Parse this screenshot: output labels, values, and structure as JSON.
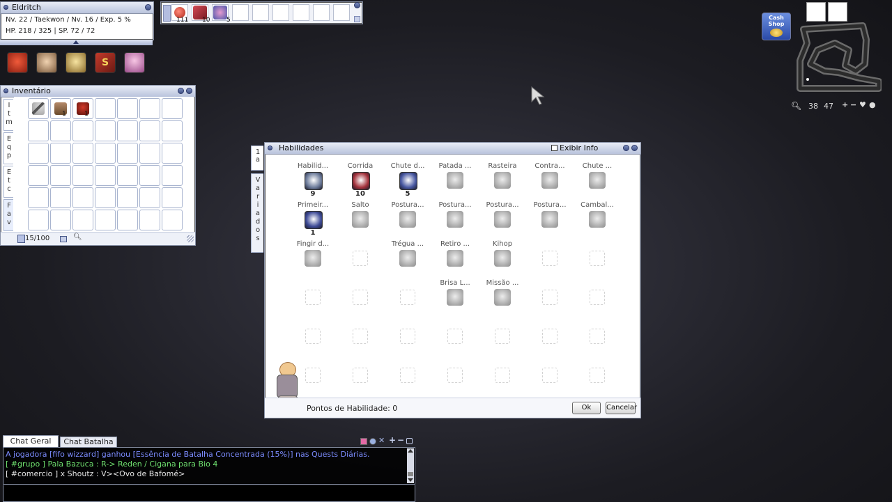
{
  "character": {
    "name": "Eldritch",
    "level_line": "Nv. 22 / Taekwon / Nv. 16 / Exp. 5 %",
    "hp_sp_line": "HP. 218 / 325 | SP. 72 / 72"
  },
  "hotbar": {
    "counts": [
      "111",
      "10",
      "5"
    ]
  },
  "minimap": {
    "cash_shop_label": "Cash Shop",
    "coord_x": "38",
    "coord_y": "47"
  },
  "inventory": {
    "title": "Inventário",
    "tabs": [
      "Itm",
      "Eqp",
      "Etc",
      "Fav"
    ],
    "capacity": "15/100",
    "items": [
      {
        "icon": "staff-icon",
        "count": ""
      },
      {
        "icon": "shirt-icon",
        "count": "1"
      },
      {
        "icon": "hood-icon",
        "count": "1"
      }
    ]
  },
  "skills": {
    "title": "Habilidades",
    "exibir_info": "Exibir Info",
    "tabs": [
      "1a",
      "Variados"
    ],
    "rows": [
      [
        {
          "name": "Habilid...",
          "level": "9",
          "learned": true,
          "color": "#6c7b9a"
        },
        {
          "name": "Corrida",
          "level": "10",
          "learned": true,
          "color": "#a2303a"
        },
        {
          "name": "Chute d...",
          "level": "5",
          "learned": true,
          "color": "#4656a0"
        },
        {
          "name": "Patada ...",
          "level": "",
          "learned": false,
          "color": "#8a8a8a"
        },
        {
          "name": "Rasteira",
          "level": "",
          "learned": false,
          "color": "#8a8a8a"
        },
        {
          "name": "Contra...",
          "level": "",
          "learned": false,
          "color": "#8a8a8a"
        },
        {
          "name": "Chute ...",
          "level": "",
          "learned": false,
          "color": "#8a8a8a"
        }
      ],
      [
        {
          "name": "Primeir...",
          "level": "1",
          "learned": true,
          "color": "#3d4a96"
        },
        {
          "name": "Salto",
          "level": "",
          "learned": false,
          "color": "#8a8a8a"
        },
        {
          "name": "Postura...",
          "level": "",
          "learned": false,
          "color": "#8a8a8a"
        },
        {
          "name": "Postura...",
          "level": "",
          "learned": false,
          "color": "#8a8a8a"
        },
        {
          "name": "Postura...",
          "level": "",
          "learned": false,
          "color": "#8a8a8a"
        },
        {
          "name": "Postura...",
          "level": "",
          "learned": false,
          "color": "#8a8a8a"
        },
        {
          "name": "Cambal...",
          "level": "",
          "learned": false,
          "color": "#8a8a8a"
        }
      ],
      [
        {
          "name": "Fingir d...",
          "level": "",
          "learned": false,
          "color": "#8a8a8a"
        },
        null,
        {
          "name": "Trégua ...",
          "level": "",
          "learned": false,
          "color": "#8a8a8a"
        },
        {
          "name": "Retiro ...",
          "level": "",
          "learned": false,
          "color": "#8a8a8a"
        },
        {
          "name": "Kihop",
          "level": "",
          "learned": false,
          "color": "#8a8a8a"
        },
        null,
        null
      ],
      [
        null,
        null,
        null,
        {
          "name": "Brisa L...",
          "level": "",
          "learned": false,
          "color": "#8a8a8a"
        },
        {
          "name": "Missão ...",
          "level": "",
          "learned": false,
          "color": "#8a8a8a"
        },
        null,
        null
      ],
      [
        null,
        null,
        null,
        null,
        null,
        null,
        null
      ],
      [
        null,
        null,
        null,
        null,
        null,
        null,
        null
      ]
    ],
    "points_label": "Pontos de Habilidade: 0",
    "ok_label": "Ok",
    "cancel_label": "Cancelar"
  },
  "chat": {
    "tabs": [
      "Chat Geral",
      "Chat Batalha"
    ],
    "messages": [
      {
        "text": "A jogadora [fifo wizzard] ganhou [Essência de Batalha Concentrada (15%)] nas Quests Diárias.",
        "color": "#7c8cff"
      },
      {
        "text": "[ #grupo ] Pala Bazuca : R-> Reden / Cigana para Bio 4",
        "color": "#6fe06f"
      },
      {
        "text": "[ #comercio ] x Shoutz : V><Ovo de Bafomé>",
        "color": "#e6e6e6"
      }
    ]
  }
}
